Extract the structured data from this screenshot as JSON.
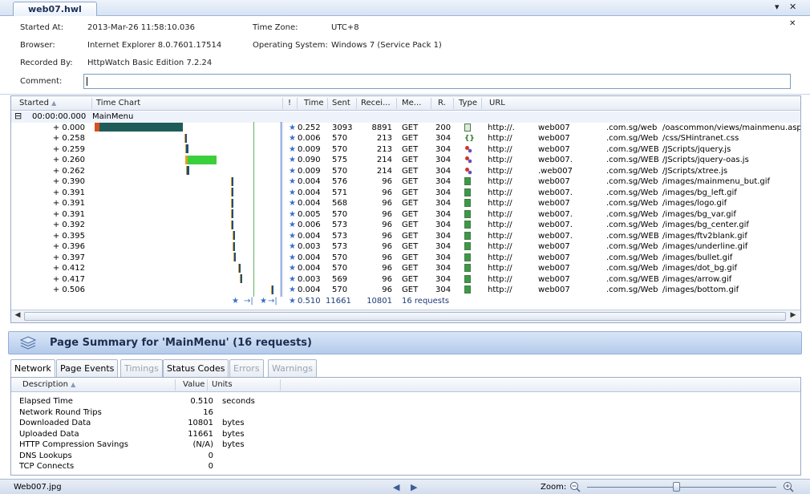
{
  "tab": {
    "title": "web07.hwl"
  },
  "window": {
    "dropdown_icon": "▾",
    "close_icon": "✕",
    "pane_close_icon": "✕"
  },
  "info": {
    "started_at_label": "Started At:",
    "started_at": "2013-Mar-26 11:58:10.036",
    "timezone_label": "Time Zone:",
    "timezone": "UTC+8",
    "browser_label": "Browser:",
    "browser": "Internet Explorer 8.0.7601.17514",
    "os_label": "Operating System:",
    "os": "Windows 7 (Service Pack 1)",
    "recorded_by_label": "Recorded By:",
    "recorded_by": "HttpWatch Basic Edition 7.2.24",
    "comment_label": "Comment:",
    "comment": ""
  },
  "grid": {
    "headers": [
      "Started",
      "Time Chart",
      "!",
      "Time",
      "Sent",
      "Recei...",
      "Me...",
      "R.",
      "Type",
      "URL"
    ],
    "page": {
      "toggle": "⊟",
      "started": "00:00:00.000",
      "name": "MainMenu"
    },
    "rows": [
      {
        "started": "+ 0.000",
        "time": "0.252",
        "sent": "3093",
        "recv": "8891",
        "method": "GET",
        "result": "200",
        "type": "page",
        "url1": "http://.",
        "url2": "web007",
        "url3": ".com.sg/web",
        "url4": "/oascommon/views/mainmenu.aspx"
      },
      {
        "started": "+ 0.258",
        "time": "0.006",
        "sent": "570",
        "recv": "213",
        "method": "GET",
        "result": "304",
        "type": "css",
        "url1": "http://",
        "url2": "web007",
        "url3": ".com.sg/Web",
        "url4": "/css/SHintranet.css"
      },
      {
        "started": "+ 0.259",
        "time": "0.009",
        "sent": "570",
        "recv": "213",
        "method": "GET",
        "result": "304",
        "type": "js",
        "url1": "http://",
        "url2": "web007",
        "url3": ".com.sg/WEB",
        "url4": "/JScripts/jquery.js"
      },
      {
        "started": "+ 0.260",
        "time": "0.090",
        "sent": "575",
        "recv": "214",
        "method": "GET",
        "result": "304",
        "type": "js",
        "url1": "http://",
        "url2": "web007.",
        "url3": ".com.sg/WEB",
        "url4": "/JScripts/jquery-oas.js"
      },
      {
        "started": "+ 0.262",
        "time": "0.009",
        "sent": "570",
        "recv": "214",
        "method": "GET",
        "result": "304",
        "type": "js",
        "url1": "http://",
        "url2": ".web007",
        "url3": ".com.sg/Web",
        "url4": "/JScripts/xtree.js"
      },
      {
        "started": "+ 0.390",
        "time": "0.004",
        "sent": "576",
        "recv": "96",
        "method": "GET",
        "result": "304",
        "type": "img",
        "url1": "http://",
        "url2": "web007",
        "url3": ".com.sg/Web",
        "url4": "/images/mainmenu_but.gif"
      },
      {
        "started": "+ 0.391",
        "time": "0.004",
        "sent": "571",
        "recv": "96",
        "method": "GET",
        "result": "304",
        "type": "img",
        "url1": "http://",
        "url2": "web007.",
        "url3": ".com.sg/Web",
        "url4": "/images/bg_left.gif"
      },
      {
        "started": "+ 0.391",
        "time": "0.004",
        "sent": "568",
        "recv": "96",
        "method": "GET",
        "result": "304",
        "type": "img",
        "url1": "http://",
        "url2": "web007",
        "url3": ".com.sg/Web",
        "url4": "/images/logo.gif"
      },
      {
        "started": "+ 0.391",
        "time": "0.005",
        "sent": "570",
        "recv": "96",
        "method": "GET",
        "result": "304",
        "type": "img",
        "url1": "http://",
        "url2": "web007.",
        "url3": ".com.sg/Web",
        "url4": "/images/bg_var.gif"
      },
      {
        "started": "+ 0.392",
        "time": "0.006",
        "sent": "573",
        "recv": "96",
        "method": "GET",
        "result": "304",
        "type": "img",
        "url1": "http://",
        "url2": "web007.",
        "url3": ".com.sg/Web",
        "url4": "/images/bg_center.gif"
      },
      {
        "started": "+ 0.395",
        "time": "0.004",
        "sent": "573",
        "recv": "96",
        "method": "GET",
        "result": "304",
        "type": "img",
        "url1": "http://",
        "url2": "web007.",
        "url3": ".com.sg/WEB",
        "url4": "/images/ftv2blank.gif"
      },
      {
        "started": "+ 0.396",
        "time": "0.003",
        "sent": "573",
        "recv": "96",
        "method": "GET",
        "result": "304",
        "type": "img",
        "url1": "http://",
        "url2": "web007",
        "url3": ".com.sg/Web",
        "url4": "/images/underline.gif"
      },
      {
        "started": "+ 0.397",
        "time": "0.004",
        "sent": "570",
        "recv": "96",
        "method": "GET",
        "result": "304",
        "type": "img",
        "url1": "http://",
        "url2": "web007",
        "url3": ".com.sg/Web",
        "url4": "/images/bullet.gif"
      },
      {
        "started": "+ 0.412",
        "time": "0.004",
        "sent": "570",
        "recv": "96",
        "method": "GET",
        "result": "304",
        "type": "img",
        "url1": "http://",
        "url2": "web007",
        "url3": ".com.sg/Web",
        "url4": "/images/dot_bg.gif"
      },
      {
        "started": "+ 0.417",
        "time": "0.003",
        "sent": "569",
        "recv": "96",
        "method": "GET",
        "result": "304",
        "type": "img",
        "url1": "http://",
        "url2": "web007",
        "url3": ".com.sg/WEB",
        "url4": "/images/arrow.gif"
      },
      {
        "started": "+ 0.506",
        "time": "0.004",
        "sent": "570",
        "recv": "96",
        "method": "GET",
        "result": "304",
        "type": "img",
        "url1": "http://",
        "url2": "web007",
        "url3": ".com.sg/Web",
        "url4": "/images/bottom.gif"
      }
    ],
    "totals": {
      "time": "0.510",
      "sent": "11661",
      "recv": "10801",
      "requests": "16 requests"
    }
  },
  "summary": {
    "title": "Page Summary for 'MainMenu' (16 requests)",
    "tabs": [
      {
        "label": "Network",
        "state": "active"
      },
      {
        "label": "Page Events",
        "state": "normal"
      },
      {
        "label": "Timings",
        "state": "disabled"
      },
      {
        "label": "Status Codes",
        "state": "normal"
      },
      {
        "label": "Errors",
        "state": "disabled"
      },
      {
        "label": "Warnings",
        "state": "disabled"
      }
    ],
    "headers": [
      "Description",
      "Value",
      "Units"
    ],
    "rows": [
      {
        "desc": "Elapsed Time",
        "value": "0.510",
        "units": "seconds"
      },
      {
        "desc": "Network Round Trips",
        "value": "16",
        "units": ""
      },
      {
        "desc": "Downloaded Data",
        "value": "10801",
        "units": "bytes"
      },
      {
        "desc": "Uploaded Data",
        "value": "11661",
        "units": "bytes"
      },
      {
        "desc": "HTTP Compression Savings",
        "value": "(N/A)",
        "units": "bytes"
      },
      {
        "desc": "DNS Lookups",
        "value": "0",
        "units": ""
      },
      {
        "desc": "TCP Connects",
        "value": "0",
        "units": ""
      }
    ]
  },
  "status": {
    "file": "Web007.jpg",
    "zoom_label": "Zoom:",
    "zoom_level": 0.47
  },
  "colors": {
    "accent": "#3b6ec9",
    "page_bar": "#1e5c5a",
    "js_bar": "#3ccf3c",
    "css_bar": "#2a7c2a"
  }
}
